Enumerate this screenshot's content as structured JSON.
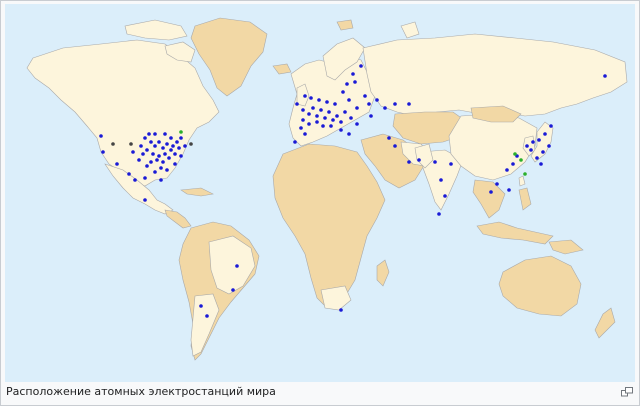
{
  "caption": "Расположение атомных электростанций мира",
  "icons": {
    "enlarge": "magnify-clip-icon"
  },
  "colors": {
    "ocean": "#dbeefa",
    "land_highlight": "#fdf5dc",
    "land_other": "#f2d8a5",
    "border": "#a9a9a9",
    "plant_active": "#1a1ad6",
    "plant_construction": "#2bb02b",
    "plant_closed": "#444444"
  }
}
